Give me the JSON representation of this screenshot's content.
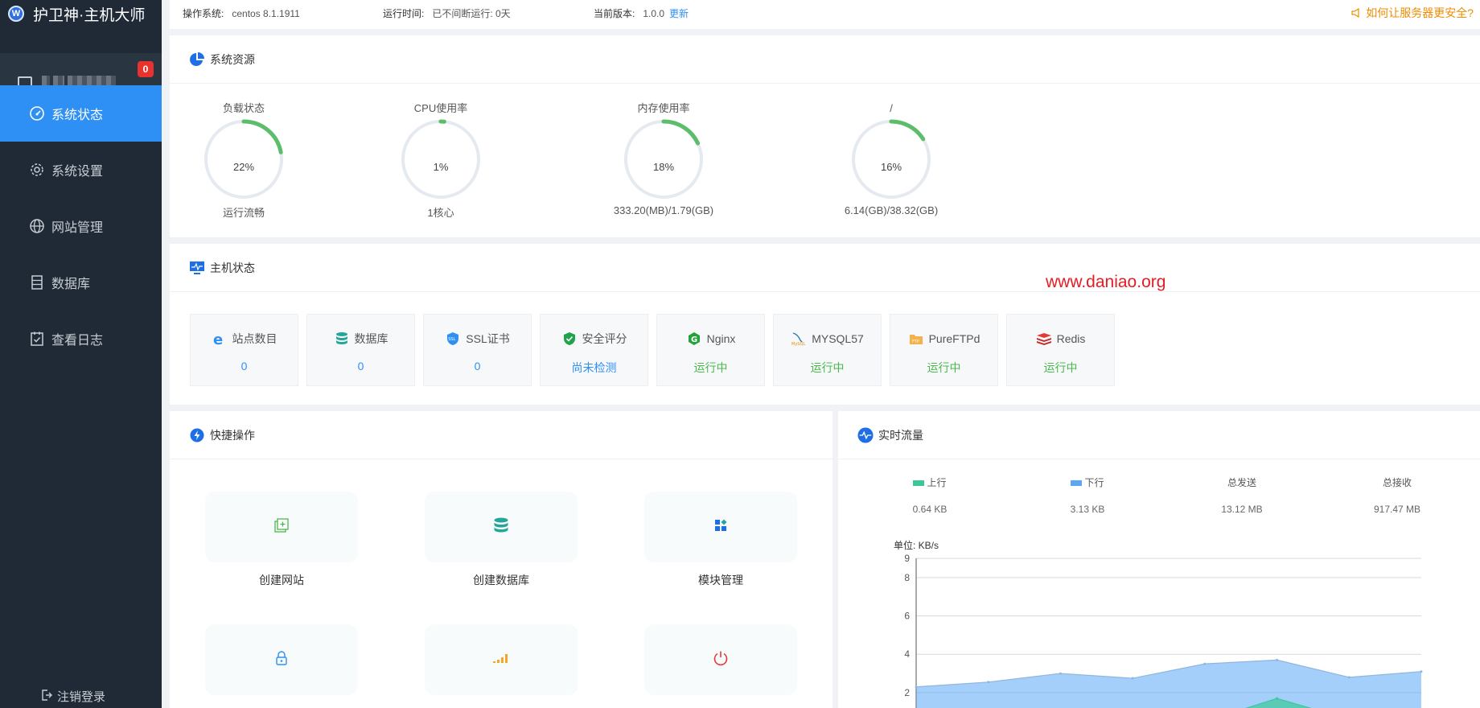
{
  "app": {
    "title": "护卫神·主机大师",
    "logo_letter": "W",
    "notification_count": "0"
  },
  "sidebar": {
    "items": [
      {
        "label": "系统状态",
        "icon": "gauge-icon",
        "active": true
      },
      {
        "label": "系统设置",
        "icon": "gear-icon",
        "active": false
      },
      {
        "label": "网站管理",
        "icon": "globe-icon",
        "active": false
      },
      {
        "label": "数据库",
        "icon": "database-icon",
        "active": false
      },
      {
        "label": "查看日志",
        "icon": "log-icon",
        "active": false
      }
    ],
    "logout": "注销登录"
  },
  "topbar": {
    "os_label": "操作系统:",
    "os_value": "centos 8.1.1911",
    "uptime_label": "运行时间:",
    "uptime_value": "已不间断运行: 0天",
    "version_label": "当前版本:",
    "version_value": "1.0.0",
    "update_link": "更新",
    "tip": "如何让服务器更安全?"
  },
  "resources": {
    "title": "系统资源",
    "gauges": [
      {
        "label": "负载状态",
        "percent": 22,
        "value": "22%",
        "sub": "运行流畅"
      },
      {
        "label": "CPU使用率",
        "percent": 1,
        "value": "1%",
        "sub": "1核心"
      },
      {
        "label": "内存使用率",
        "percent": 18,
        "value": "18%",
        "sub": "333.20(MB)/1.79(GB)"
      },
      {
        "label": "/",
        "percent": 16,
        "value": "16%",
        "sub": "6.14(GB)/38.32(GB)"
      }
    ],
    "gauge_color": "#5cbd6b"
  },
  "host_status": {
    "title": "主机状态",
    "cards": [
      {
        "label": "站点数目",
        "value": "0",
        "icon": "ie-icon",
        "green": false
      },
      {
        "label": "数据库",
        "value": "0",
        "icon": "database-icon",
        "green": false
      },
      {
        "label": "SSL证书",
        "value": "0",
        "icon": "ssl-shield-icon",
        "green": false
      },
      {
        "label": "安全评分",
        "value": "尚未检测",
        "icon": "security-shield-icon",
        "green": false
      },
      {
        "label": "Nginx",
        "value": "运行中",
        "icon": "nginx-icon",
        "green": true
      },
      {
        "label": "MYSQL57",
        "value": "运行中",
        "icon": "mysql-icon",
        "green": true
      },
      {
        "label": "PureFTPd",
        "value": "运行中",
        "icon": "ftp-icon",
        "green": true
      },
      {
        "label": "Redis",
        "value": "运行中",
        "icon": "redis-icon",
        "green": true
      }
    ]
  },
  "quick_ops": {
    "title": "快捷操作",
    "items": [
      {
        "label": "创建网站",
        "icon": "create-site-icon"
      },
      {
        "label": "创建数据库",
        "icon": "create-database-icon"
      },
      {
        "label": "模块管理",
        "icon": "modules-icon"
      },
      {
        "label": "",
        "icon": "lock-icon"
      },
      {
        "label": "",
        "icon": "chart-bars-icon"
      },
      {
        "label": "",
        "icon": "power-icon"
      }
    ]
  },
  "traffic": {
    "title": "实时流量",
    "up_label": "上行",
    "up_value": "0.64 KB",
    "down_label": "下行",
    "down_value": "3.13 KB",
    "sent_label": "总发送",
    "sent_value": "13.12 MB",
    "recv_label": "总接收",
    "recv_value": "917.47 MB",
    "up_color": "#3cc79a",
    "down_color": "#5aa8f5"
  },
  "chart_data": {
    "type": "area",
    "ylabel": "单位: KB/s",
    "yticks": [
      2,
      4,
      6,
      8,
      9
    ],
    "ylim": [
      1.2,
      9
    ],
    "x": [
      0,
      1,
      2,
      3,
      4,
      5,
      6,
      7
    ],
    "series": [
      {
        "name": "下行",
        "values": [
          2.3,
          2.55,
          3.0,
          2.75,
          3.5,
          3.7,
          2.8,
          3.1
        ]
      },
      {
        "name": "上行",
        "values": [
          0.2,
          0.3,
          0.4,
          0.3,
          0.5,
          1.7,
          0.6,
          0.5
        ]
      }
    ]
  },
  "watermark": "www.daniao.org"
}
